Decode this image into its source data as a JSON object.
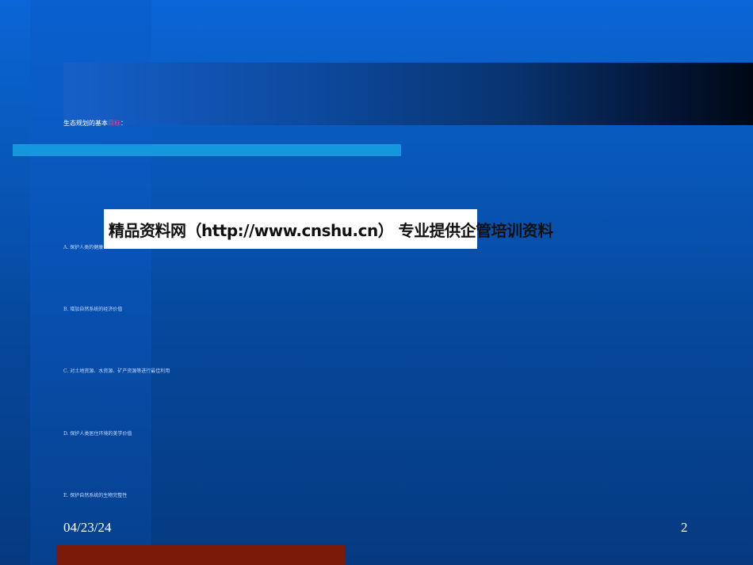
{
  "slide": {
    "title_prefix": "生态规划的基本",
    "title_highlight": "目标",
    "title_suffix": "：",
    "banner_text": "精品资料网（http://www.cnshu.cn） 专业提供企管培训资料",
    "options": [
      "A. 保护人类的健康",
      "B. 增加自然系统的经济价值",
      "C. 对土地资源、水资源、矿产资源等进行最佳利用",
      "D. 保护人类居住环境的美学价值",
      "E. 保护自然系统的生物完整性"
    ],
    "footer_date": "04/23/24",
    "page_number": "2"
  },
  "colors": {
    "background": "#0857b8",
    "title_highlight": "#ff3b7a",
    "accent_strip": "#1597dd",
    "bottom_bar": "#7a1a08"
  }
}
